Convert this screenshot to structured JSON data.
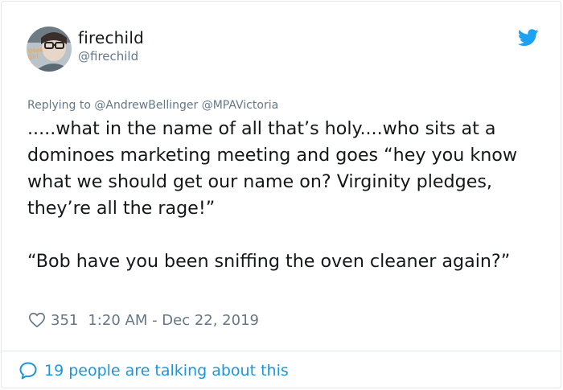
{
  "user": {
    "display_name": "firechild",
    "handle": "@firechild",
    "avatar_icon": "profile-photo",
    "avatar_text": "geek girl"
  },
  "reply": {
    "prefix": "Replying to",
    "mentions": [
      "@AndrewBellinger",
      "@MPAVictoria"
    ]
  },
  "tweet": {
    "text": ".....what in the name of all that’s holy....who sits at a dominoes marketing meeting and goes “hey you know what we should get our name on?  Virginity pledges, they’re all the rage!”\n\n“Bob have you been sniffing the oven cleaner again?”"
  },
  "stats": {
    "likes": "351",
    "timestamp": "1:20 AM - Dec 22, 2019"
  },
  "footer": {
    "talking": "19 people are talking about this"
  },
  "icons": {
    "brand": "twitter-bird-icon",
    "like": "heart-icon",
    "conversation": "speech-bubble-icon"
  },
  "colors": {
    "text": "#14171a",
    "secondary": "#657786",
    "brand": "#1da1f2",
    "link": "#1b95e0",
    "border": "#e1e8ed"
  }
}
